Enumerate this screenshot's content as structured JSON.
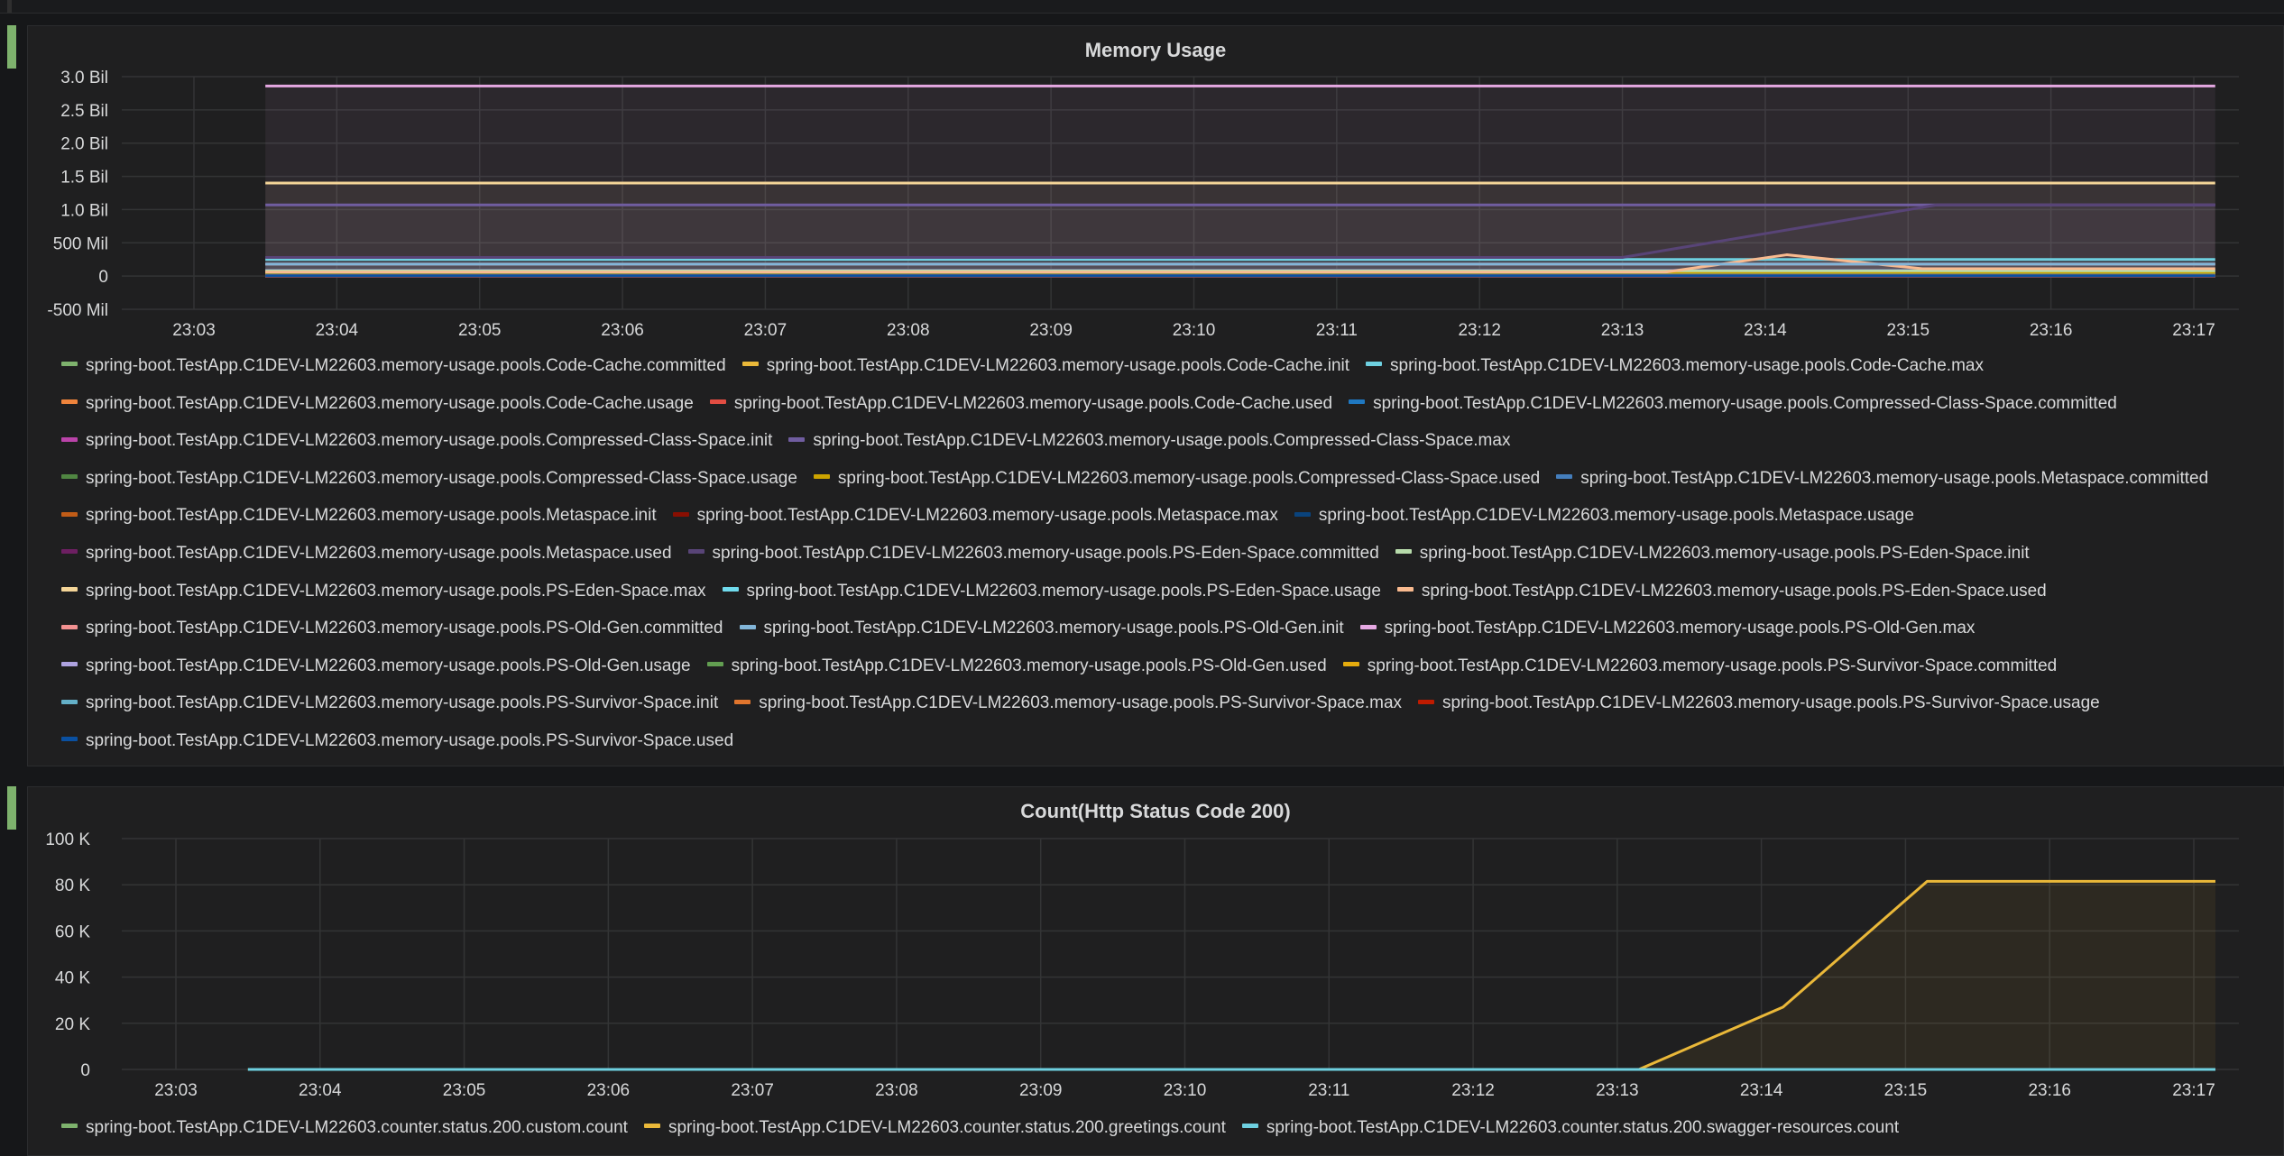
{
  "panels": [
    {
      "title": "Memory Usage",
      "chart_data": {
        "type": "area",
        "x_ticks": [
          "23:03",
          "23:04",
          "23:05",
          "23:06",
          "23:07",
          "23:08",
          "23:09",
          "23:10",
          "23:11",
          "23:12",
          "23:13",
          "23:14",
          "23:15",
          "23:16",
          "23:17"
        ],
        "y_ticks": [
          "3.0 Bil",
          "2.5 Bil",
          "2.0 Bil",
          "1.5 Bil",
          "1.0 Bil",
          "500 Mil",
          "0",
          "-500 Mil"
        ],
        "y_tick_values": [
          3000000000,
          2500000000,
          2000000000,
          1500000000,
          1000000000,
          500000000,
          0,
          -500000000
        ],
        "ylim": [
          -500000000,
          3000000000
        ],
        "xlim": [
          "23:02.5",
          "23:17.4"
        ],
        "grid": true,
        "legend_placement": "bottom",
        "series": [
          {
            "name": "spring-boot.TestApp.C1DEV-LM22603.memory-usage.pools.Code-Cache.committed",
            "color": "#7eb26d",
            "x": [
              "23:03.5",
              "23:17.15"
            ],
            "y": [
              30000000,
              30000000
            ]
          },
          {
            "name": "spring-boot.TestApp.C1DEV-LM22603.memory-usage.pools.Code-Cache.init",
            "color": "#eab839",
            "x": [
              "23:03.5",
              "23:17.15"
            ],
            "y": [
              2500000,
              2500000
            ]
          },
          {
            "name": "spring-boot.TestApp.C1DEV-LM22603.memory-usage.pools.Code-Cache.max",
            "color": "#6ed0e0",
            "x": [
              "23:03.5",
              "23:17.15"
            ],
            "y": [
              250000000,
              250000000
            ]
          },
          {
            "name": "spring-boot.TestApp.C1DEV-LM22603.memory-usage.pools.Code-Cache.usage",
            "color": "#ef843c",
            "x": [
              "23:03.5",
              "23:17.15"
            ],
            "y": [
              0,
              0
            ]
          },
          {
            "name": "spring-boot.TestApp.C1DEV-LM22603.memory-usage.pools.Code-Cache.used",
            "color": "#e24d42",
            "x": [
              "23:03.5",
              "23:17.15"
            ],
            "y": [
              28000000,
              28000000
            ]
          },
          {
            "name": "spring-boot.TestApp.C1DEV-LM22603.memory-usage.pools.Compressed-Class-Space.committed",
            "color": "#1f78c1",
            "x": [
              "23:03.5",
              "23:17.15"
            ],
            "y": [
              60000000,
              60000000
            ]
          },
          {
            "name": "spring-boot.TestApp.C1DEV-LM22603.memory-usage.pools.Compressed-Class-Space.init",
            "color": "#ba43a9",
            "x": [
              "23:03.5",
              "23:17.15"
            ],
            "y": [
              0,
              0
            ]
          },
          {
            "name": "spring-boot.TestApp.C1DEV-LM22603.memory-usage.pools.Compressed-Class-Space.max",
            "color": "#705da0",
            "x": [
              "23:03.5",
              "23:13.2",
              "23:15.2",
              "23:17.15"
            ],
            "y": [
              1070000000,
              1070000000,
              1070000000,
              1070000000
            ]
          },
          {
            "name": "spring-boot.TestApp.C1DEV-LM22603.memory-usage.pools.Compressed-Class-Space.usage",
            "color": "#508642",
            "x": [
              "23:03.5",
              "23:17.15"
            ],
            "y": [
              0,
              0
            ]
          },
          {
            "name": "spring-boot.TestApp.C1DEV-LM22603.memory-usage.pools.Compressed-Class-Space.used",
            "color": "#cca300",
            "x": [
              "23:03.5",
              "23:17.15"
            ],
            "y": [
              55000000,
              55000000
            ]
          },
          {
            "name": "spring-boot.TestApp.C1DEV-LM22603.memory-usage.pools.Metaspace.committed",
            "color": "#447ebc",
            "x": [
              "23:03.5",
              "23:17.15"
            ],
            "y": [
              90000000,
              90000000
            ]
          },
          {
            "name": "spring-boot.TestApp.C1DEV-LM22603.memory-usage.pools.Metaspace.init",
            "color": "#c15c17",
            "x": [
              "23:03.5",
              "23:17.15"
            ],
            "y": [
              0,
              0
            ]
          },
          {
            "name": "spring-boot.TestApp.C1DEV-LM22603.memory-usage.pools.Metaspace.max",
            "color": "#890f02",
            "x": [
              "23:03.5",
              "23:17.15"
            ],
            "y": [
              0,
              0
            ]
          },
          {
            "name": "spring-boot.TestApp.C1DEV-LM22603.memory-usage.pools.Metaspace.usage",
            "color": "#0a437c",
            "x": [
              "23:03.5",
              "23:17.15"
            ],
            "y": [
              0,
              0
            ]
          },
          {
            "name": "spring-boot.TestApp.C1DEV-LM22603.memory-usage.pools.Metaspace.used",
            "color": "#6d1f62",
            "x": [
              "23:03.5",
              "23:17.15"
            ],
            "y": [
              85000000,
              85000000
            ]
          },
          {
            "name": "spring-boot.TestApp.C1DEV-LM22603.memory-usage.pools.PS-Eden-Space.committed",
            "color": "#584477",
            "x": [
              "23:03.5",
              "23:13.0",
              "23:15.2",
              "23:17.15"
            ],
            "y": [
              280000000,
              280000000,
              1070000000,
              1070000000
            ]
          },
          {
            "name": "spring-boot.TestApp.C1DEV-LM22603.memory-usage.pools.PS-Eden-Space.init",
            "color": "#b7dbab",
            "x": [
              "23:03.5",
              "23:17.15"
            ],
            "y": [
              80000000,
              80000000
            ]
          },
          {
            "name": "spring-boot.TestApp.C1DEV-LM22603.memory-usage.pools.PS-Eden-Space.max",
            "color": "#f4d598",
            "x": [
              "23:03.5",
              "23:17.15"
            ],
            "y": [
              1400000000,
              1400000000
            ]
          },
          {
            "name": "spring-boot.TestApp.C1DEV-LM22603.memory-usage.pools.PS-Eden-Space.usage",
            "color": "#70dbed",
            "x": [
              "23:03.5",
              "23:17.15"
            ],
            "y": [
              0,
              0
            ]
          },
          {
            "name": "spring-boot.TestApp.C1DEV-LM22603.memory-usage.pools.PS-Eden-Space.used",
            "color": "#f9ba8f",
            "x": [
              "23:03.5",
              "23:13.3",
              "23:14.15",
              "23:15.1",
              "23:17.15"
            ],
            "y": [
              60000000,
              60000000,
              320000000,
              110000000,
              110000000
            ]
          },
          {
            "name": "spring-boot.TestApp.C1DEV-LM22603.memory-usage.pools.PS-Old-Gen.committed",
            "color": "#f29191",
            "x": [
              "23:03.5",
              "23:17.15"
            ],
            "y": [
              180000000,
              180000000
            ]
          },
          {
            "name": "spring-boot.TestApp.C1DEV-LM22603.memory-usage.pools.PS-Old-Gen.init",
            "color": "#82b5d8",
            "x": [
              "23:03.5",
              "23:17.15"
            ],
            "y": [
              180000000,
              180000000
            ]
          },
          {
            "name": "spring-boot.TestApp.C1DEV-LM22603.memory-usage.pools.PS-Old-Gen.max",
            "color": "#e5a8e2",
            "x": [
              "23:03.5",
              "23:17.15"
            ],
            "y": [
              2860000000,
              2860000000
            ]
          },
          {
            "name": "spring-boot.TestApp.C1DEV-LM22603.memory-usage.pools.PS-Old-Gen.usage",
            "color": "#aea2e0",
            "x": [
              "23:03.5",
              "23:17.15"
            ],
            "y": [
              0,
              0
            ]
          },
          {
            "name": "spring-boot.TestApp.C1DEV-LM22603.memory-usage.pools.PS-Old-Gen.used",
            "color": "#629e51",
            "x": [
              "23:03.5",
              "23:17.15"
            ],
            "y": [
              20000000,
              20000000
            ]
          },
          {
            "name": "spring-boot.TestApp.C1DEV-LM22603.memory-usage.pools.PS-Survivor-Space.committed",
            "color": "#e5ac0e",
            "x": [
              "23:03.5",
              "23:17.15"
            ],
            "y": [
              12000000,
              12000000
            ]
          },
          {
            "name": "spring-boot.TestApp.C1DEV-LM22603.memory-usage.pools.PS-Survivor-Space.init",
            "color": "#64b0c8",
            "x": [
              "23:03.5",
              "23:17.15"
            ],
            "y": [
              12000000,
              12000000
            ]
          },
          {
            "name": "spring-boot.TestApp.C1DEV-LM22603.memory-usage.pools.PS-Survivor-Space.max",
            "color": "#e0752d",
            "x": [
              "23:03.5",
              "23:17.15"
            ],
            "y": [
              12000000,
              12000000
            ]
          },
          {
            "name": "spring-boot.TestApp.C1DEV-LM22603.memory-usage.pools.PS-Survivor-Space.usage",
            "color": "#bf1b00",
            "x": [
              "23:03.5",
              "23:17.15"
            ],
            "y": [
              0,
              0
            ]
          },
          {
            "name": "spring-boot.TestApp.C1DEV-LM22603.memory-usage.pools.PS-Survivor-Space.used",
            "color": "#0a50a1",
            "x": [
              "23:03.5",
              "23:17.15"
            ],
            "y": [
              5000000,
              5000000
            ]
          }
        ]
      }
    },
    {
      "title": "Count(Http Status Code 200)",
      "chart_data": {
        "type": "area",
        "x_ticks": [
          "23:03",
          "23:04",
          "23:05",
          "23:06",
          "23:07",
          "23:08",
          "23:09",
          "23:10",
          "23:11",
          "23:12",
          "23:13",
          "23:14",
          "23:15",
          "23:16",
          "23:17"
        ],
        "y_ticks": [
          "100 K",
          "80 K",
          "60 K",
          "40 K",
          "20 K",
          "0"
        ],
        "y_tick_values": [
          100000,
          80000,
          60000,
          40000,
          20000,
          0
        ],
        "ylim": [
          0,
          100000
        ],
        "xlim": [
          "23:02.5",
          "23:17.4"
        ],
        "grid": true,
        "legend_placement": "bottom",
        "series": [
          {
            "name": "spring-boot.TestApp.C1DEV-LM22603.counter.status.200.custom.count",
            "color": "#7eb26d",
            "x": [
              "23:03.5",
              "23:17.15"
            ],
            "y": [
              0,
              0
            ]
          },
          {
            "name": "spring-boot.TestApp.C1DEV-LM22603.counter.status.200.greetings.count",
            "color": "#eab839",
            "x": [
              "23:03.5",
              "23:13.15",
              "23:14.15",
              "23:15.15",
              "23:17.15"
            ],
            "y": [
              0,
              0,
              27000,
              81500,
              81500
            ]
          },
          {
            "name": "spring-boot.TestApp.C1DEV-LM22603.counter.status.200.swagger-resources.count",
            "color": "#6ed0e0",
            "x": [
              "23:03.5",
              "23:17.15"
            ],
            "y": [
              0,
              0
            ]
          }
        ]
      }
    }
  ]
}
